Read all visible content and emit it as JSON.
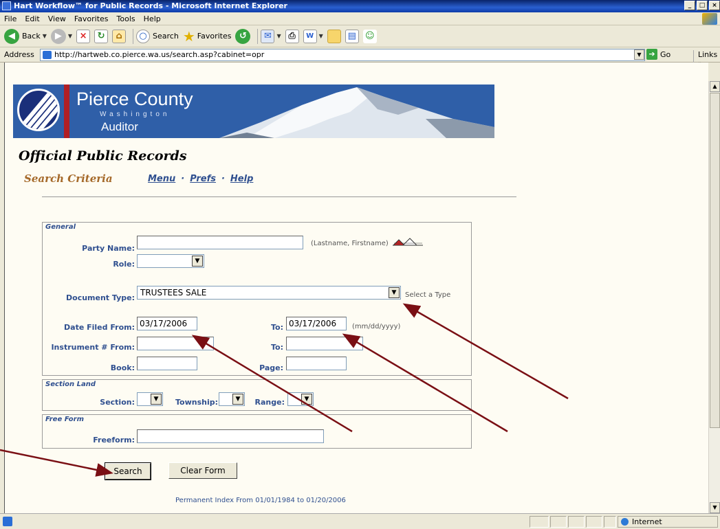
{
  "window": {
    "title": "Hart Workflow™ for Public Records - Microsoft Internet Explorer",
    "buttons": [
      "_",
      "□",
      "×"
    ]
  },
  "menubar": [
    "File",
    "Edit",
    "View",
    "Favorites",
    "Tools",
    "Help"
  ],
  "toolbar": {
    "back": "Back",
    "search": "Search",
    "favorites": "Favorites"
  },
  "addressbar": {
    "label": "Address",
    "url": "http://hartweb.co.pierce.wa.us/search.asp?cabinet=opr",
    "go": "Go",
    "links": "Links »"
  },
  "banner": {
    "title": "Pierce County",
    "state": "Washington",
    "office": "Auditor"
  },
  "page": {
    "heading": "Official Public Records",
    "subheading": "Search Criteria",
    "nav": [
      "Menu",
      "Prefs",
      "Help"
    ]
  },
  "form": {
    "general": {
      "title": "General",
      "party_name": {
        "label": "Party Name:",
        "value": "",
        "hint": "(Lastname, Firstname)"
      },
      "role": {
        "label": "Role:",
        "value": ""
      },
      "document_type": {
        "label": "Document Type:",
        "value": "TRUSTEES SALE",
        "hint": "Select a Type"
      },
      "date_from": {
        "label": "Date Filed From:",
        "value": "03/17/2006"
      },
      "date_to": {
        "label": "To:",
        "value": "03/17/2006",
        "hint": "(mm/dd/yyyy)"
      },
      "instr_from": {
        "label": "Instrument # From:",
        "value": ""
      },
      "instr_to": {
        "label": "To:",
        "value": ""
      },
      "book": {
        "label": "Book:",
        "value": ""
      },
      "page": {
        "label": "Page:",
        "value": ""
      }
    },
    "section_land": {
      "title": "Section Land",
      "section": "Section:",
      "township": "Township:",
      "range": "Range:"
    },
    "free_form": {
      "title": "Free Form",
      "label": "Freeform:",
      "value": ""
    },
    "search_button": "Search",
    "clear_button": "Clear Form",
    "footer": "Permanent Index From 01/01/1984 to 01/20/2006"
  },
  "statusbar": {
    "zone": "Internet"
  },
  "colors": {
    "label_blue": "#2f4f8f",
    "subheading_brown": "#a5692a",
    "annotation_arrow": "#7a0f14"
  }
}
